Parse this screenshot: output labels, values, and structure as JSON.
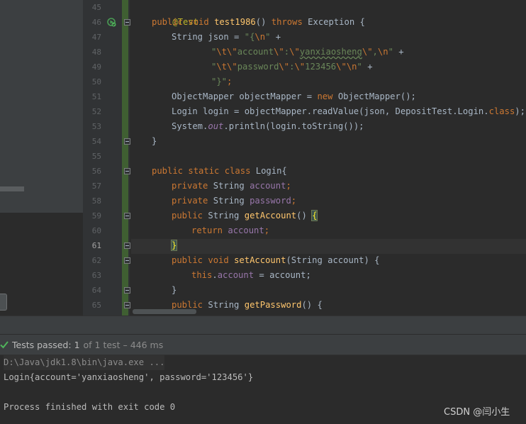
{
  "colors": {
    "background": "#2b2b2b",
    "keyword": "#cc7832",
    "string": "#6a8759",
    "annotation": "#bbb529",
    "method": "#ffc66d",
    "field": "#9876aa",
    "pass_green": "#4fb45b"
  },
  "editor": {
    "line_numbers": [
      "45",
      "46",
      "47",
      "48",
      "49",
      "50",
      "51",
      "52",
      "53",
      "54",
      "55",
      "56",
      "57",
      "58",
      "59",
      "60",
      "61",
      "62",
      "63",
      "64",
      "65"
    ],
    "current_line": "61",
    "lines": {
      "l45": {
        "ann": "@Test"
      },
      "l46": {
        "kw1": "public void ",
        "fn": "test1986",
        "rest1": "() ",
        "kw2": "throws ",
        "rest2": "Exception {"
      },
      "l47": {
        "pre": "String json = ",
        "s1": "\"{",
        "e1": "\\n",
        "s2": "\"",
        "post": " +"
      },
      "l48": {
        "s1": "\"",
        "e1": "\\t\\\"",
        "s2": "account",
        "e2": "\\\"",
        "s3": ":",
        "e3": "\\\"",
        "s4": "yanxiaosheng",
        "e4": "\\\"",
        "s5": ",",
        "e5": "\\n",
        "s6": "\"",
        "post": " +"
      },
      "l49": {
        "s1": "\"",
        "e1": "\\t\\\"",
        "s2": "password",
        "e2": "\\\"",
        "s3": ":",
        "e3": "\\\"",
        "s4": "123456",
        "e4": "\\\"\\n",
        "s5": "\"",
        "post": " +"
      },
      "l50": {
        "s1": "\"}\"",
        "post": ";"
      },
      "l51": {
        "pre": "ObjectMapper objectMapper = ",
        "kw": "new ",
        "post": "ObjectMapper();"
      },
      "l52": {
        "pre": "Login login = objectMapper.readValue(json, DepositTest.Login.",
        "kw": "class",
        "post": ");"
      },
      "l53": {
        "pre": "System.",
        "stat": "out",
        "post": ".println(login.toString());"
      },
      "l54": {
        "text": "}"
      },
      "l56": {
        "kw": "public static class ",
        "post": "Login{"
      },
      "l57": {
        "kw": "private ",
        "mid": "String ",
        "fld": "account",
        "post": ";"
      },
      "l58": {
        "kw": "private ",
        "mid": "String ",
        "fld": "password",
        "post": ";"
      },
      "l59": {
        "kw": "public ",
        "mid": "String ",
        "fn": "getAccount",
        "post": "() ",
        "brace": "{"
      },
      "l60": {
        "kw": "return ",
        "fld": "account",
        "post": ";"
      },
      "l61": {
        "brace": "}"
      },
      "l62": {
        "kw1": "public void ",
        "fn": "setAccount",
        "post": "(String account) {"
      },
      "l63": {
        "kw": "this",
        "dot": ".",
        "fld": "account",
        "post": " = account;"
      },
      "l64": {
        "text": "}"
      },
      "l65": {
        "kw": "public ",
        "mid": "String ",
        "fn": "getPassword",
        "post": "() {"
      }
    }
  },
  "tests": {
    "label": "Tests passed:",
    "count": "1",
    "of": "of 1 test",
    "dash": "–",
    "time": "446 ms"
  },
  "console": {
    "command": "D:\\Java\\jdk1.8\\bin\\java.exe ...",
    "output": "Login{account='yanxiaosheng', password='123456'}",
    "exit": "Process finished with exit code 0"
  },
  "watermark": "CSDN @闫小生"
}
